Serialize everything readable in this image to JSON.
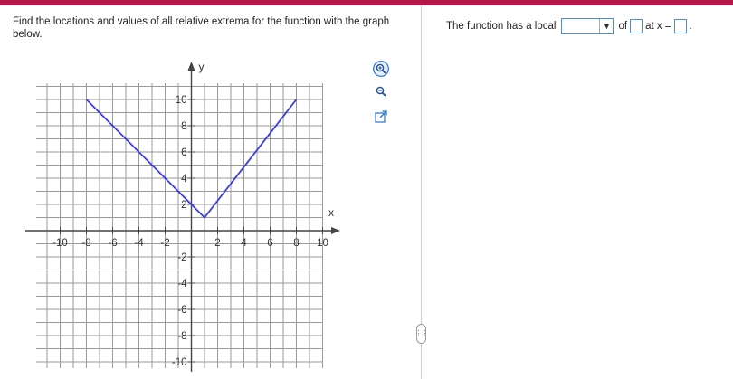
{
  "question": {
    "text": "Find the locations and values of all relative extrema for the function with the graph below."
  },
  "graph": {
    "x_axis_label": "x",
    "y_axis_label": "y",
    "x_tick_labels": [
      "-10",
      "-8",
      "-6",
      "-4",
      "-2",
      "2",
      "4",
      "6",
      "8",
      "10"
    ],
    "y_tick_labels": [
      "10",
      "8",
      "6",
      "4",
      "2",
      "-2",
      "-4",
      "-6",
      "-8",
      "-10"
    ],
    "colors": {
      "curve": "#3a3de0",
      "grid": "#9a9a9a",
      "axis": "#444444"
    }
  },
  "chart_data": {
    "type": "line",
    "title": "",
    "xlabel": "x",
    "ylabel": "y",
    "xlim": [
      -10,
      10
    ],
    "ylim": [
      -10,
      10
    ],
    "grid": true,
    "series": [
      {
        "x": [
          -8,
          1,
          8
        ],
        "y": [
          10,
          1,
          10
        ]
      }
    ]
  },
  "tools": [
    {
      "icon": "zoom-in-icon"
    },
    {
      "icon": "zoom-out-icon"
    },
    {
      "icon": "external-link-icon"
    }
  ],
  "answer": {
    "prefix": "The function has a local",
    "dropdown_value": "",
    "of_label": "of",
    "at_label": "at x =",
    "suffix": "."
  }
}
